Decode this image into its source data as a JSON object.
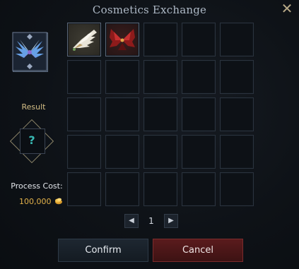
{
  "window": {
    "title": "Cosmetics Exchange",
    "close_icon": "close-icon",
    "accent_gold": "#d5bf86",
    "accent_red": "#5a1b1d"
  },
  "left_panel": {
    "preview_icon": "blue-feather-wings-icon",
    "result_label": "Result",
    "result_icon": "question-mark-icon",
    "result_symbol": "?",
    "cost_label": "Process Cost:",
    "cost_value": "100,000",
    "currency_icon": "gold-coin-icon"
  },
  "grid": {
    "rows": 5,
    "cols": 5,
    "items": [
      {
        "slot": 0,
        "icon": "white-wings-icon"
      },
      {
        "slot": 1,
        "icon": "red-demon-wings-icon"
      }
    ]
  },
  "pager": {
    "prev_icon": "chevron-left-icon",
    "page": "1",
    "next_icon": "chevron-right-icon"
  },
  "actions": {
    "confirm_label": "Confirm",
    "cancel_label": "Cancel"
  }
}
